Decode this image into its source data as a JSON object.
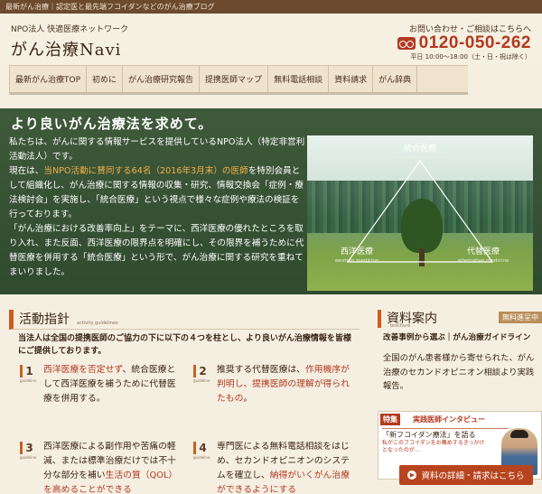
{
  "topbar": {
    "text": "最新がん治療｜認定医と最先端フコイダンなどのがん治療ブログ"
  },
  "header": {
    "org": "NPO法人 快適医療ネットワーク",
    "site_name": "がん治療Navi",
    "contact_label": "お問い合わせ・ご相談はこちらへ",
    "phone": "0120-050-262",
    "hours": "平日 10:00〜18:00（土・日・祝は除く）"
  },
  "nav": {
    "items": [
      {
        "label": "最新がん治療TOP"
      },
      {
        "label": "初めに"
      },
      {
        "label": "がん治療研究報告"
      },
      {
        "label": "提携医師マップ"
      },
      {
        "label": "無料電話相談"
      },
      {
        "label": "資料請求"
      },
      {
        "label": "がん辞典"
      }
    ]
  },
  "hero": {
    "title": "より良いがん治療法を求めて。",
    "p1": "私たちは、がんに関する情報サービスを提供しているNPO法人（特定非営利活動法人）です。",
    "p2_a": "現在は、",
    "p2_hl": "当NPO活動に賛同する64名（2016年3月末）の医師",
    "p2_b": "を特別会員として組織化し、がん治療に関する情報の収集・研究、情報交換会「症例・療法検討会」を実施し、「統合医療」という視点で様々な症例や療法の検証を行っております。",
    "p3": "「がん治療における改善率向上」をテーマに、西洋医療の優れたところを取り入れ、また反面、西洋医療の限界点を明確にし、その限界を補うために代替医療を併用する「統合医療」という形で、がん治療に関する研究を重ねてまいりました。",
    "diagram": {
      "top": {
        "label": "統合医療",
        "sub": "integrative medicine"
      },
      "left": {
        "label": "西洋医療",
        "sub": "western medicine"
      },
      "right": {
        "label": "代替医療",
        "sub": "alternative medicine"
      }
    }
  },
  "activities": {
    "title": "活動指針",
    "subtitle": "activity guidelines",
    "intro": "当法人は全国の提携医師のご協力の下に以下の４つを柱とし、より良いがん治療情報を皆様にご提供しております。",
    "guideline_label": "guideline",
    "items": [
      {
        "num": "1",
        "hl": "西洋医療を否定せず",
        "text": "、統合医療として西洋医療を補うために代替医療を併用する。"
      },
      {
        "num": "2",
        "text": "推奨する代替医療は、",
        "hl": "作用機序が判明し、提携医師の理解が得られたもの",
        "text2": "。"
      },
      {
        "num": "3",
        "text": "西洋医療による副作用や苦痛の軽減、または標準治療だけでは不十分な部分を補い",
        "hl": "生活の質（QOL）を高めることができる"
      },
      {
        "num": "4",
        "text": "専門医による無料電話相談をはじめ、セカンドオピニオンのシステムを確立し、",
        "hl": "納得がいくがん治療ができるようにする"
      }
    ]
  },
  "side": {
    "title": "資料案内",
    "subtitle": "brochure",
    "badge": "無料進呈中",
    "caption": "改善事例から選ぶ｜がん治療ガイドライン",
    "text": "全国のがん患者様から寄せられた、がん治療のセカンドオピニオン相談より実践報告。",
    "feature": {
      "tag": "特集",
      "title": "実践医師インタビュー",
      "name": "「新フコイダン療法」を語る",
      "desc": "私がこのフコイダンをお薦めするきっかけとなったのが…"
    },
    "cta": "資料の詳細・請求はこちら"
  },
  "colors": {
    "accent": "#b3391f",
    "brand_brown": "#6b4a2e",
    "hero_green": "#3f5a3a",
    "highlight": "#f0b04a"
  }
}
